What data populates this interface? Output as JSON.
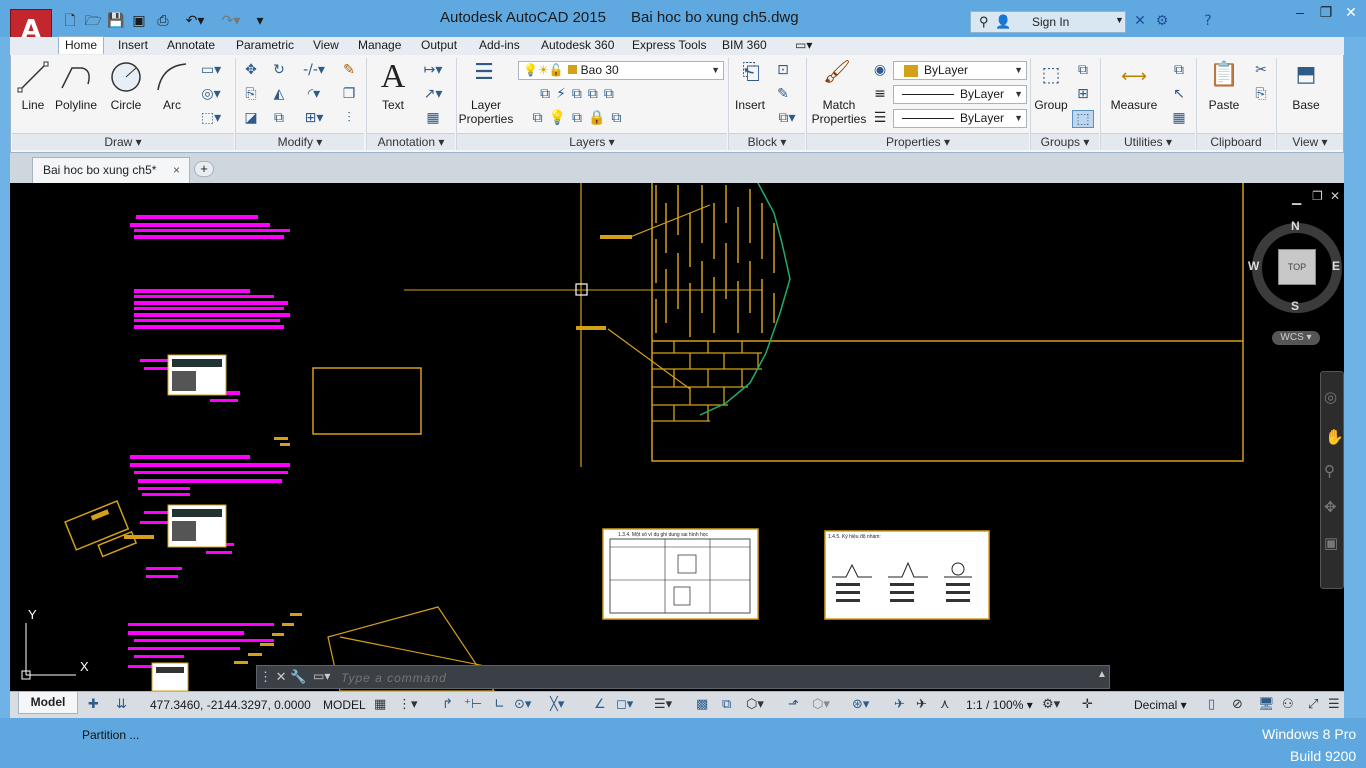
{
  "app": {
    "title": "Autodesk AutoCAD 2015",
    "document": "Bai hoc bo xung ch5.dwg",
    "logo_letter": "A",
    "sign_in": "Sign In"
  },
  "ribbon_tabs": [
    "Home",
    "Insert",
    "Annotate",
    "Parametric",
    "View",
    "Manage",
    "Output",
    "Add-ins",
    "Autodesk 360",
    "Express Tools",
    "BIM 360"
  ],
  "panels": {
    "draw": {
      "title": "Draw",
      "tools": [
        "Line",
        "Polyline",
        "Circle",
        "Arc"
      ]
    },
    "modify": {
      "title": "Modify"
    },
    "annotation": {
      "title": "Annotation",
      "text_label": "Text"
    },
    "layers": {
      "title": "Layers",
      "layer_props_1": "Layer",
      "layer_props_2": "Properties",
      "current_layer": "Bao 30"
    },
    "block": {
      "title": "Block",
      "insert_label": "Insert"
    },
    "properties": {
      "title": "Properties",
      "match_1": "Match",
      "match_2": "Properties",
      "color": "ByLayer",
      "linetype": "ByLayer",
      "lineweight": "ByLayer"
    },
    "groups": {
      "title": "Groups",
      "group_label": "Group"
    },
    "utilities": {
      "title": "Utilities",
      "measure_label": "Measure"
    },
    "clipboard": {
      "title": "Clipboard",
      "paste_label": "Paste"
    },
    "view": {
      "title": "View",
      "base_label": "Base"
    }
  },
  "doc_tab": {
    "label": "Bai hoc bo xung ch5*"
  },
  "viewcube": {
    "n": "N",
    "s": "S",
    "e": "E",
    "w": "W",
    "top": "TOP",
    "wcs": "WCS"
  },
  "ucs": {
    "x": "X",
    "y": "Y"
  },
  "drawings": {
    "table1_title": "1.3.4. Một số ví dụ ghi dung sai hình học",
    "table2_title": "1.4.5. Ký hiệu độ nhám:"
  },
  "command": {
    "placeholder": "Type a command"
  },
  "status": {
    "layout_model": "Model",
    "coords": "477.3460, -2144.3297, 0.0000",
    "space": "MODEL",
    "scale": "1:1 / 100%",
    "units": "Decimal"
  },
  "taskbar": {
    "item": "Partition ...",
    "os_line1": "Windows 8 Pro",
    "os_line2": "Build 9200"
  },
  "colors": {
    "canvas": "#000000",
    "ribbon": "#f5f5f5",
    "titlebar": "#5fa9e0",
    "accent": "#c1272d",
    "layer_yellow": "#d4a017",
    "magenta": "#ff00ff"
  }
}
